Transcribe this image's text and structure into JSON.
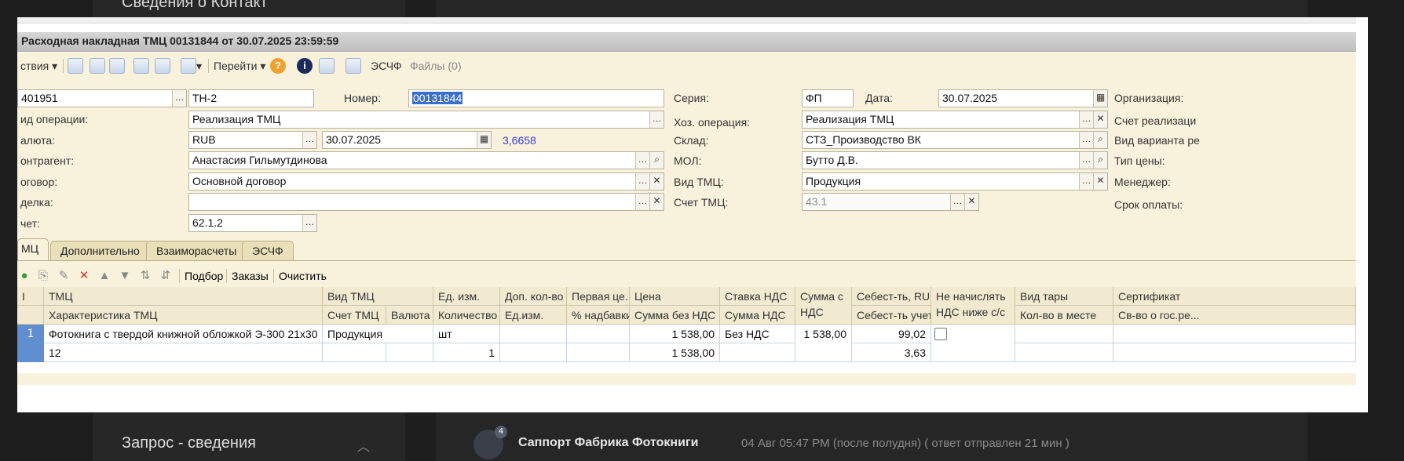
{
  "background": {
    "top_section_title": "Сведения о Контакт",
    "bottom_section_title": "Запрос - сведения",
    "avatar_badge": "4",
    "sender": "Саппорт Фабрика Фотокниги",
    "message_meta": "04 Авг 05:47 PM (после полудня) ( ответ отправлен 21 мин )"
  },
  "window": {
    "title": "Расходная накладная ТМЦ 00131844 от 30.07.2025 23:59:59"
  },
  "toolbar": {
    "actions": "ствия",
    "goto": "Перейти",
    "eschf": "ЭСЧФ",
    "files": "Файлы (0)"
  },
  "form": {
    "code_value": "401951",
    "doc_type_value": "ТН-2",
    "number_label": "Номер:",
    "number_value": "00131844",
    "series_label": "Серия:",
    "series_value": "ФП",
    "date_label": "Дата:",
    "date_value": "30.07.2025",
    "org_label": "Организация:",
    "op_type_label": "ид операции:",
    "op_type_value": "Реализация ТМЦ",
    "hoz_op_label": "Хоз. операция:",
    "hoz_op_value": "Реализация ТМЦ",
    "sales_acc_label": "Счет реализаци",
    "currency_label": "алюта:",
    "currency_value": "RUB",
    "rate_date_value": "30.07.2025",
    "rate_value": "3,6658",
    "warehouse_label": "Склад:",
    "warehouse_value": "СТЗ_Производство ВК",
    "variant_label": "Вид варианта ре",
    "contractor_label": "онтрагент:",
    "contractor_value": "Анастасия Гильмутдинова",
    "mol_label": "МОЛ:",
    "mol_value": "Бутто Д.В.",
    "price_type_label": "Тип цены:",
    "contract_label": "оговор:",
    "contract_value": "Основной договор",
    "tmc_type_label": "Вид ТМЦ:",
    "tmc_type_value": "Продукция",
    "manager_label": "Менеджер:",
    "deal_label": "делка:",
    "deal_value": "",
    "tmc_acc_label": "Счет ТМЦ:",
    "tmc_acc_value": "43.1",
    "payment_term_label": "Срок оплаты:",
    "account_label": "чет:",
    "account_value": "62.1.2"
  },
  "tabs": [
    {
      "label": "МЦ"
    },
    {
      "label": "Дополнительно"
    },
    {
      "label": "Взаиморасчеты"
    },
    {
      "label": "ЭСЧФ"
    }
  ],
  "toolbar2": {
    "pick": "Подбор",
    "orders": "Заказы",
    "clear": "Очистить"
  },
  "table": {
    "header_top": {
      "c0": "I",
      "c1": "ТМЦ",
      "c2": "Вид ТМЦ",
      "c4": "Ед. изм.",
      "c5": "Доп. кол-во",
      "c6": "Первая це...",
      "c7": "Цена",
      "c8": "Ставка НДС",
      "c9": "Сумма с НДС",
      "c10": "Себест-ть, RUB",
      "c11": "Не начислять НДС ниже с/с",
      "c12": "Вид тары",
      "c13": "Сертификат"
    },
    "header_bottom": {
      "c1": "Характеристика ТМЦ",
      "c2": "Счет ТМЦ",
      "c3": "Валюта",
      "c4": "Количество",
      "c5": "Ед.изм.",
      "c6": "% надбавки",
      "c7": "Сумма без НДС",
      "c8": "Сумма НДС",
      "c10": "Себест-ть учет.",
      "c12": "Кол-во в месте",
      "c13": "Св-во о гос.ре..."
    },
    "row1_top": {
      "num": "1",
      "c1": "Фотокнига с твердой книжной обложкой Э-300 21х30",
      "c2": "Продукция",
      "c4": "шт",
      "c7": "1 538,00",
      "c8": "Без НДС",
      "c9": "1 538,00",
      "c10": "99,02"
    },
    "row1_bottom": {
      "c1": "12",
      "c4": "1",
      "c7": "1 538,00",
      "c10": "3,63"
    }
  }
}
